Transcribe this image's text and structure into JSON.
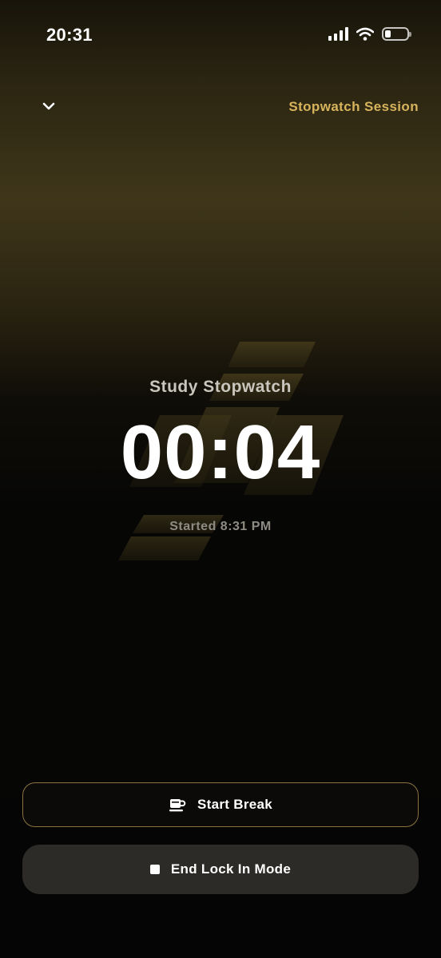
{
  "status_bar": {
    "time": "20:31",
    "icons": [
      "cellular-signal-icon",
      "wifi-icon",
      "battery-icon"
    ]
  },
  "header": {
    "collapse_icon": "chevron-down-icon",
    "title": "Stopwatch Session"
  },
  "session": {
    "label": "Study Stopwatch",
    "timer": "00:04",
    "started": "Started 8:31 PM"
  },
  "actions": {
    "start_break": {
      "label": "Start Break",
      "icon": "coffee-cup-icon"
    },
    "end_lock_in": {
      "label": "End Lock In Mode",
      "icon": "stop-icon"
    }
  },
  "colors": {
    "accent_gold": "#d7b45c",
    "button_border": "#8a7442",
    "secondary_button_bg": "#2d2b27",
    "background": "#050505"
  }
}
